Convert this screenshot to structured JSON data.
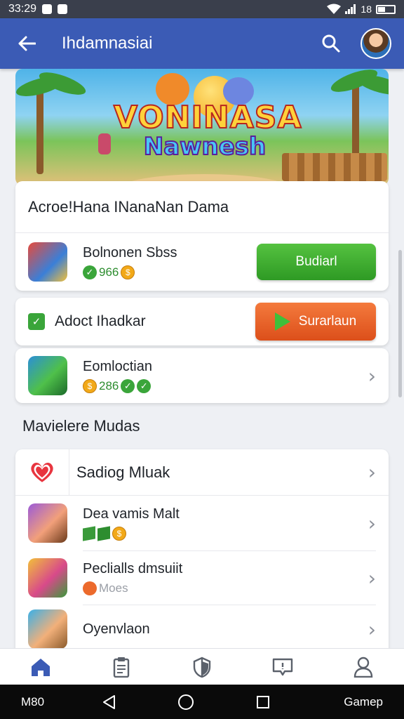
{
  "status_bar": {
    "time": "33:29",
    "signal_text": "18"
  },
  "app_bar": {
    "title": "Ihdamnasiai",
    "back_icon": "back-arrow-icon",
    "search_icon": "search-icon"
  },
  "hero": {
    "logo_line1": "VONINASA",
    "logo_line2": "Nawnesh"
  },
  "card1": {
    "header": "Acroe!Hana INanaNan Dama",
    "item": {
      "title": "Bolnonen Sbss",
      "sub_value": "966",
      "button": "Budiarl"
    }
  },
  "card2": {
    "label": "Adoct Ihadkar",
    "button": "Surarlaun"
  },
  "card3": {
    "title": "Eomloctian",
    "sub_value": "286"
  },
  "section_title": "Mavielere Mudas",
  "list": {
    "items": [
      {
        "title": "Sadiog Mluak"
      },
      {
        "title": "Dea vamis Malt"
      },
      {
        "title": "Peclialls dmsuiit",
        "sub": "Moes"
      },
      {
        "title": "Oyenvlaon"
      }
    ]
  },
  "bottom_nav": {
    "items": [
      "home-icon",
      "clipboard-icon",
      "shield-icon",
      "chat-icon",
      "profile-icon"
    ]
  },
  "system_bar": {
    "left_text": "M80",
    "right_text": "Gamep"
  },
  "colors": {
    "primary": "#3b5bb5",
    "green_button": "#3aa53a",
    "orange_button": "#e85c22"
  }
}
